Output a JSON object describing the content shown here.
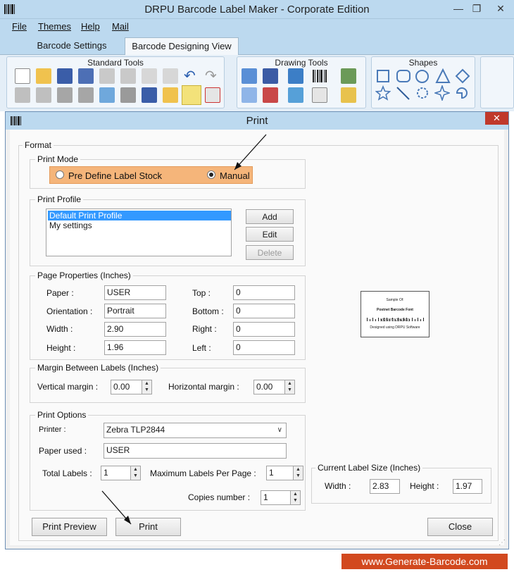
{
  "app": {
    "title": "DRPU Barcode Label Maker - Corporate Edition",
    "window_controls": [
      "—",
      "❐",
      "✕"
    ]
  },
  "menu": [
    "File",
    "Themes",
    "Help",
    "Mail"
  ],
  "ribbon_tabs": [
    "Barcode Settings",
    "Barcode Designing View"
  ],
  "ribbon_groups": {
    "standard": "Standard Tools",
    "drawing": "Drawing Tools",
    "shapes": "Shapes"
  },
  "dialog": {
    "title": "Print",
    "close": "✕",
    "format_legend": "Format",
    "print_mode": {
      "legend": "Print Mode",
      "option1": "Pre Define Label Stock",
      "option2": "Manual",
      "selected": "Manual"
    },
    "print_profile": {
      "legend": "Print Profile",
      "items": [
        "Default Print Profile",
        "My settings"
      ],
      "add": "Add",
      "edit": "Edit",
      "delete": "Delete"
    },
    "page_properties": {
      "legend": "Page Properties (Inches)",
      "paper_label": "Paper :",
      "paper": "USER",
      "orientation_label": "Orientation :",
      "orientation": "Portrait",
      "width_label": "Width :",
      "width": "2.90",
      "height_label": "Height :",
      "height": "1.96",
      "top_label": "Top :",
      "top": "0",
      "bottom_label": "Bottom :",
      "bottom": "0",
      "right_label": "Right :",
      "right": "0",
      "left_label": "Left :",
      "left": "0"
    },
    "margin": {
      "legend": "Margin Between Labels (Inches)",
      "vertical_label": "Vertical margin :",
      "vertical": "0.00",
      "horizontal_label": "Horizontal margin :",
      "horizontal": "0.00"
    },
    "print_options": {
      "legend": "Print Options",
      "printer_label": "Printer :",
      "printer": "Zebra TLP2844",
      "paper_used_label": "Paper used :",
      "paper_used": "USER",
      "total_labels_label": "Total Labels :",
      "total_labels": "1",
      "max_per_page_label": "Maximum Labels Per Page :",
      "max_per_page": "1",
      "copies_label": "Copies number :",
      "copies": "1"
    },
    "sample": {
      "line1": "Sample Of:",
      "line2": "Postnet Barcode Font",
      "line3": "932587012363433",
      "line4": "Designed using DRPU Software"
    },
    "label_size": {
      "legend": "Current Label Size (Inches)",
      "width_label": "Width :",
      "width": "2.83",
      "height_label": "Height :",
      "height": "1.97"
    },
    "buttons": {
      "preview": "Print Preview",
      "print": "Print",
      "close": "Close"
    }
  },
  "footer": "www.Generate-Barcode.com"
}
